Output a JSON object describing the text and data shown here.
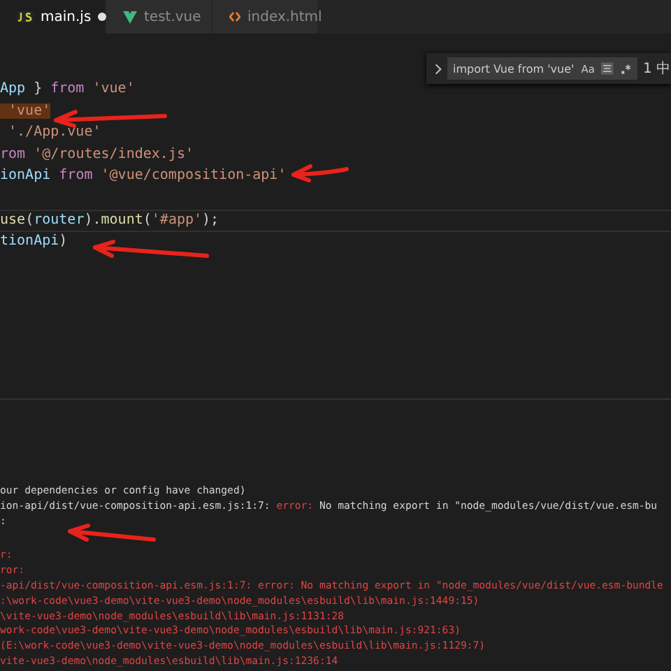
{
  "tabs": [
    {
      "label": "main.js",
      "selected": true,
      "modified": true
    },
    {
      "label": "test.vue",
      "selected": false,
      "modified": false
    },
    {
      "label": "index.html",
      "selected": false,
      "modified": false
    }
  ],
  "find": {
    "value": "import Vue from 'vue'",
    "match_case": "Aa",
    "whole_word_on": true,
    "result": "1 中"
  },
  "code": [
    {
      "current": false,
      "segments": [
        {
          "kind": "variable",
          "text": "App"
        },
        {
          "kind": "plain",
          "text": " } "
        },
        {
          "kind": "keyword",
          "text": "from "
        },
        {
          "kind": "string",
          "text": "'vue'"
        }
      ]
    },
    {
      "current": false,
      "segments": [
        {
          "kind": "string",
          "text": " 'vue'",
          "highlight": true
        }
      ]
    },
    {
      "current": false,
      "segments": [
        {
          "kind": "string",
          "text": " './App.vue'"
        }
      ]
    },
    {
      "current": false,
      "segments": [
        {
          "kind": "keyword",
          "text": "rom "
        },
        {
          "kind": "string",
          "text": "'@/routes/index.js'"
        }
      ]
    },
    {
      "current": false,
      "segments": [
        {
          "kind": "variable",
          "text": "ionApi "
        },
        {
          "kind": "keyword",
          "text": "from "
        },
        {
          "kind": "string",
          "text": "'@vue/composition-api'"
        }
      ]
    },
    {
      "current": false
    },
    {
      "current": true,
      "segments": [
        {
          "kind": "function",
          "text": "use"
        },
        {
          "kind": "plain",
          "text": "("
        },
        {
          "kind": "variable",
          "text": "router"
        },
        {
          "kind": "plain",
          "text": ")."
        },
        {
          "kind": "function",
          "text": "mount"
        },
        {
          "kind": "plain",
          "text": "("
        },
        {
          "kind": "string",
          "text": "'#app'"
        },
        {
          "kind": "plain",
          "text": ");"
        }
      ]
    },
    {
      "current": false,
      "segments": [
        {
          "kind": "variable",
          "text": "tionApi"
        },
        {
          "kind": "plain",
          "text": ")"
        }
      ]
    }
  ],
  "terminal": [
    [
      {
        "segments": [
          {
            "kind": "plain",
            "text": "our dependencies or config have changed)"
          }
        ]
      },
      {
        "segments": [
          {
            "kind": "plain",
            "text": "ion-api/dist/vue-composition-api.esm.js:1:7: "
          },
          {
            "kind": "error",
            "text": "error:"
          },
          {
            "kind": "plain",
            "text": " No matching export in \"node_modules/vue/dist/vue.esm-bu"
          }
        ]
      },
      {
        "segments": [
          {
            "kind": "plain",
            "text": ":"
          }
        ]
      }
    ],
    [
      {
        "segments": [
          {
            "kind": "error",
            "text": "r:"
          }
        ]
      },
      {
        "segments": [
          {
            "kind": "error",
            "text": "ror:"
          }
        ]
      },
      {
        "segments": [
          {
            "kind": "error",
            "text": "-api/dist/vue-composition-api.esm.js:1:7: error: No matching export in \"node_modules/vue/dist/vue.esm-bundle"
          }
        ]
      },
      {
        "segments": [
          {
            "kind": "error",
            "text": ":\\work-code\\vue3-demo\\vite-vue3-demo\\node_modules\\esbuild\\lib\\main.js:1449:15)"
          }
        ]
      },
      {
        "segments": [
          {
            "kind": "error",
            "text": "\\vite-vue3-demo\\node_modules\\esbuild\\lib\\main.js:1131:28"
          }
        ]
      },
      {
        "segments": [
          {
            "kind": "error",
            "text": "work-code\\vue3-demo\\vite-vue3-demo\\node_modules\\esbuild\\lib\\main.js:921:63)"
          }
        ]
      },
      {
        "segments": [
          {
            "kind": "error",
            "text": "(E:\\work-code\\vue3-demo\\vite-vue3-demo\\node_modules\\esbuild\\lib\\main.js:1129:7)"
          }
        ]
      },
      {
        "segments": [
          {
            "kind": "error",
            "text": "vite-vue3-demo\\node_modules\\esbuild\\lib\\main.js:1236:14"
          }
        ]
      }
    ]
  ]
}
